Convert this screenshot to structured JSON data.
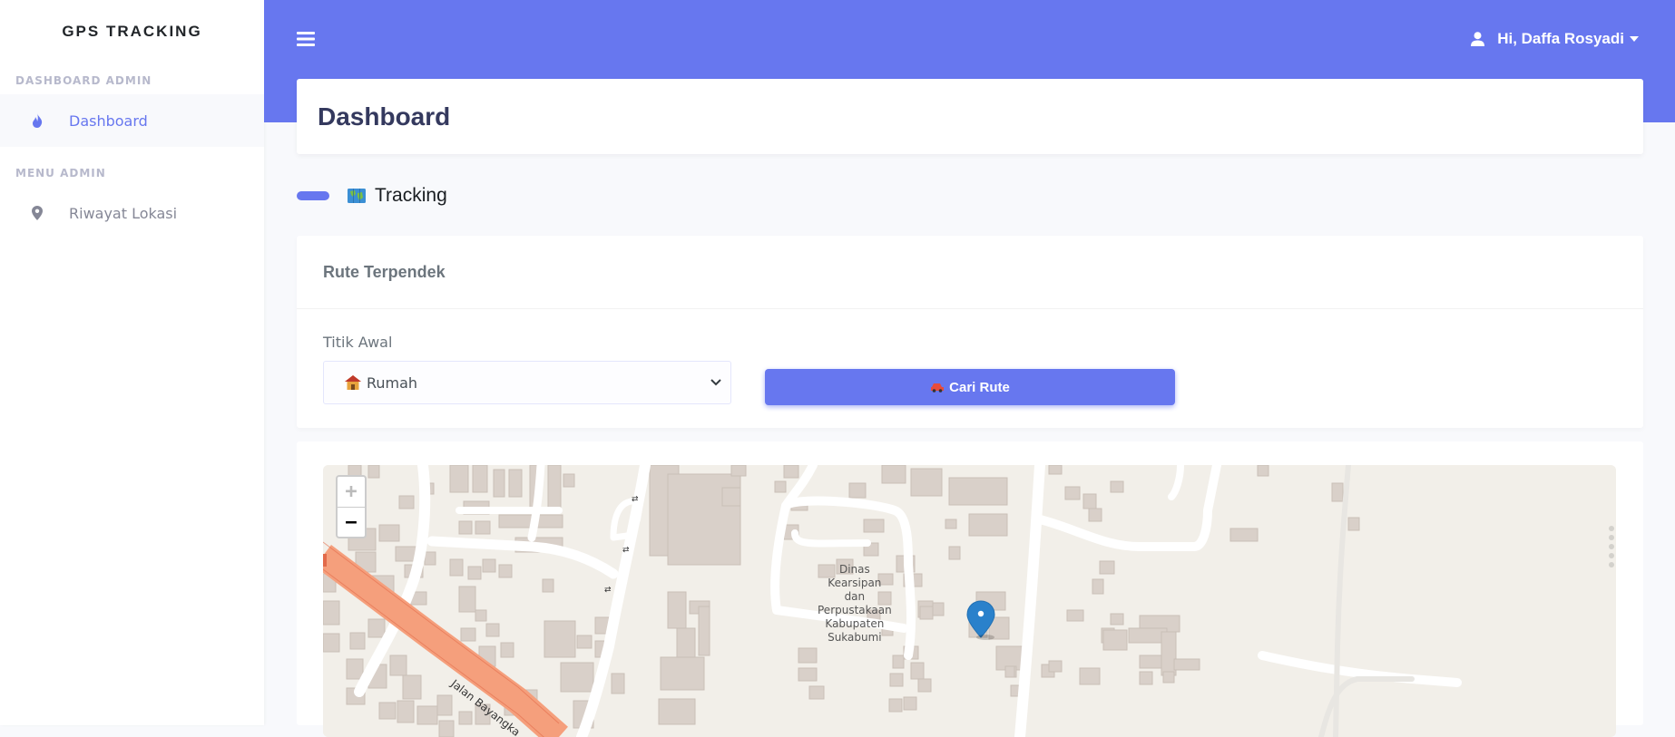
{
  "brand": "GPS TRACKING",
  "sidebar": {
    "headings": [
      "DASHBOARD ADMIN",
      "MENU ADMIN"
    ],
    "items": [
      {
        "label": "Dashboard",
        "icon": "fire-icon",
        "active": true
      },
      {
        "label": "Riwayat Lokasi",
        "icon": "map-marker-icon",
        "active": false
      }
    ]
  },
  "topbar": {
    "user_greeting": "Hi, Daffa Rosyadi",
    "user_icon": "user-icon",
    "menu_icon": "hamburger-icon"
  },
  "page": {
    "title": "Dashboard",
    "section_title": "Tracking"
  },
  "route_card": {
    "title": "Rute Terpendek",
    "start_label": "Titik Awal",
    "start_value": "Rumah",
    "button_label": "Cari Rute"
  },
  "map": {
    "zoom_in": "+",
    "zoom_out": "−",
    "poi_label": [
      "Dinas",
      "Kearsipan",
      "dan",
      "Perpustakaan",
      "Kabupaten",
      "Sukabumi"
    ],
    "road_label": "Jalan Bayangka",
    "marker_color": "#2a81cb"
  },
  "colors": {
    "primary": "#6777ef",
    "background": "#f8f9fc"
  }
}
